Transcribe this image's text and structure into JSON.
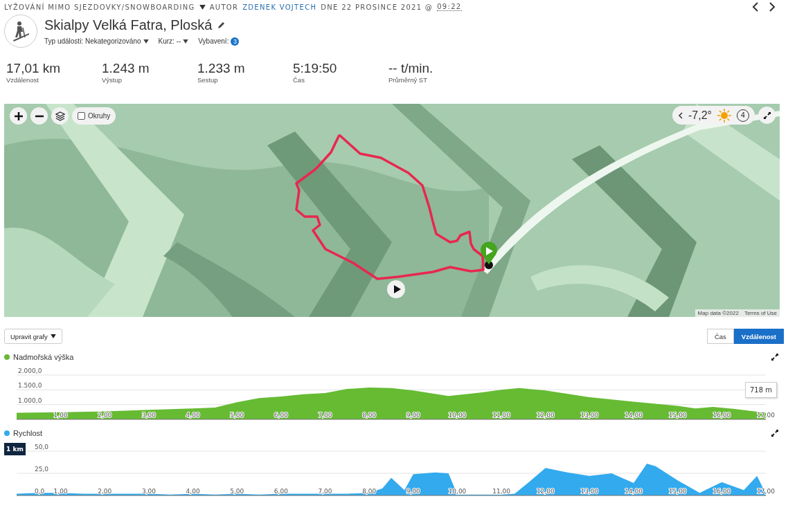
{
  "header": {
    "activity_type": "LYŽOVÁNÍ MIMO SJEZDOVKY/SNOWBOARDING",
    "author_label": "AUTOR",
    "author": "ZDENEK VOJTECH",
    "date": "DNE 22 PROSINCE 2021 @",
    "time": "09:22"
  },
  "title": "Skialpy Velká Fatra, Ploská",
  "meta": [
    {
      "kind": "dropdown",
      "label": "Typ události: Nekategorizováno"
    },
    {
      "kind": "dropdown",
      "label": "Kurz: --"
    },
    {
      "kind": "badge",
      "label": "Vybavení:",
      "badge": "3"
    }
  ],
  "stats": [
    {
      "value": "17,01 km",
      "label": "Vzdálenost"
    },
    {
      "value": "1.243 m",
      "label": "Výstup"
    },
    {
      "value": "1.233 m",
      "label": "Sestup"
    },
    {
      "value": "5:19:50",
      "label": "Čas"
    },
    {
      "value": "-- t/min.",
      "label": "Průměrný ST"
    }
  ],
  "map": {
    "kind": "picture",
    "overlay_toggle": {
      "label": "Okruhy",
      "checked": false
    },
    "weather": {
      "temperature": "-7,2°",
      "wind": "4"
    },
    "attribution": [
      "Map data ©2022",
      "Terms of Use"
    ]
  },
  "chart_controls": {
    "edit_button": "Upravit grafy",
    "axis_toggle": [
      {
        "label": "Čas",
        "selected": false
      },
      {
        "label": "Vzdálenost",
        "selected": true
      }
    ]
  },
  "charts": [
    {
      "title": "Nadmořská výška",
      "tooltip": "718 m",
      "chart_data": {
        "type": "area",
        "x": [
          0,
          1,
          2,
          3,
          4,
          4.5,
          5,
          5.5,
          6,
          6.5,
          7,
          7.5,
          8,
          8.5,
          9,
          9.8,
          10.5,
          11,
          11.4,
          12,
          13,
          14,
          15,
          15.4,
          15.8,
          16.3,
          17
        ],
        "series": [
          {
            "color": "#66bb33",
            "values": [
              720,
              740,
              770,
              820,
              870,
              900,
              1080,
              1220,
              1270,
              1350,
              1390,
              1530,
              1580,
              1560,
              1480,
              1290,
              1400,
              1500,
              1560,
              1480,
              1250,
              1100,
              960,
              870,
              920,
              850,
              720
            ]
          }
        ],
        "xlim": [
          0,
          17
        ],
        "ylim": [
          500,
          2000
        ],
        "xticks": [
          {
            "value": 1,
            "label": "1,00"
          },
          {
            "value": 2,
            "label": "2,00"
          },
          {
            "value": 3,
            "label": "3,00"
          },
          {
            "value": 4,
            "label": "4,00"
          },
          {
            "value": 5,
            "label": "5,00"
          },
          {
            "value": 6,
            "label": "6,00"
          },
          {
            "value": 7,
            "label": "7,00"
          },
          {
            "value": 8,
            "label": "8,00"
          },
          {
            "value": 9,
            "label": "9,00"
          },
          {
            "value": 10,
            "label": "10,00"
          },
          {
            "value": 11,
            "label": "11,00"
          },
          {
            "value": 12,
            "label": "12,00"
          },
          {
            "value": 13,
            "label": "13,00"
          },
          {
            "value": 14,
            "label": "14,00"
          },
          {
            "value": 15,
            "label": "15,00"
          },
          {
            "value": 16,
            "label": "16,00"
          },
          {
            "value": 17,
            "label": "17,00"
          }
        ],
        "yticks": [
          {
            "value": 1000,
            "label": "1.000,0"
          },
          {
            "value": 1500,
            "label": "1.500,0"
          },
          {
            "value": 2000,
            "label": "2.000,0"
          }
        ]
      }
    },
    {
      "title": "Rychlost",
      "marker": "1 km",
      "chart_data": {
        "type": "area",
        "x": [
          0,
          0.5,
          1,
          1.5,
          2,
          2.5,
          3,
          3.5,
          4,
          4.5,
          5,
          5.5,
          6,
          6.5,
          7,
          7.5,
          8,
          8.3,
          8.5,
          8.8,
          9,
          9.5,
          9.8,
          10,
          10.5,
          11,
          11.3,
          11.6,
          12,
          12.5,
          13,
          13.5,
          14,
          14.3,
          14.5,
          15,
          15.5,
          16,
          16.5,
          16.8,
          17
        ],
        "series": [
          {
            "color": "#33aaee",
            "values": [
              2,
              3,
              3,
              2,
              2,
              2,
              2,
              1,
              2,
              1,
              2,
              1,
              2,
              2,
              2,
              2,
              3,
              8,
              20,
              6,
              24,
              26,
              25,
              1,
              1,
              1,
              2,
              14,
              31,
              26,
              22,
              25,
              14,
              36,
              33,
              17,
              3,
              15,
              6,
              22,
              2
            ]
          }
        ],
        "xlim": [
          0,
          17
        ],
        "ylim": [
          0,
          50
        ],
        "xticks": [
          {
            "value": 1,
            "label": "1,00"
          },
          {
            "value": 2,
            "label": "2,00"
          },
          {
            "value": 3,
            "label": "3,00"
          },
          {
            "value": 4,
            "label": "4,00"
          },
          {
            "value": 5,
            "label": "5,00"
          },
          {
            "value": 6,
            "label": "6,00"
          },
          {
            "value": 7,
            "label": "7,00"
          },
          {
            "value": 8,
            "label": "8,00"
          },
          {
            "value": 9,
            "label": "9,00"
          },
          {
            "value": 10,
            "label": "10,00"
          },
          {
            "value": 11,
            "label": "11,00"
          },
          {
            "value": 12,
            "label": "12,00"
          },
          {
            "value": 13,
            "label": "13,00"
          },
          {
            "value": 14,
            "label": "14,00"
          },
          {
            "value": 15,
            "label": "15,00"
          },
          {
            "value": 16,
            "label": "16,00"
          },
          {
            "value": 17,
            "label": "17,00"
          }
        ],
        "yticks": [
          {
            "value": 0,
            "label": "0,0"
          },
          {
            "value": 25,
            "label": "25,0"
          },
          {
            "value": 50,
            "label": "50,0"
          }
        ]
      }
    }
  ]
}
